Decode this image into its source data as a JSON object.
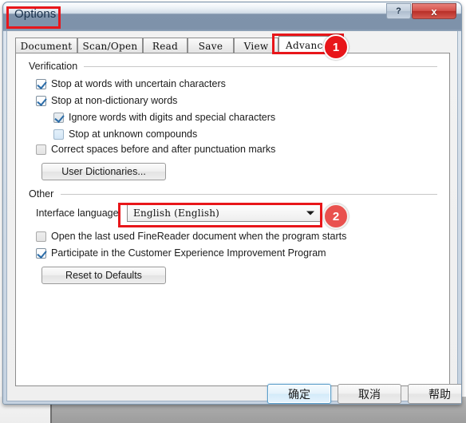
{
  "window": {
    "title": "Options",
    "help_button": "?",
    "close_button": "x"
  },
  "tabs": [
    {
      "label": "Document",
      "active": false
    },
    {
      "label": "Scan/Open",
      "active": false
    },
    {
      "label": "Read",
      "active": false
    },
    {
      "label": "Save",
      "active": false
    },
    {
      "label": "View",
      "active": false
    },
    {
      "label": "Advanced",
      "active": true
    }
  ],
  "groups": {
    "verification": {
      "label": "Verification",
      "checkboxes": [
        {
          "label": "Stop at words with uncertain characters",
          "checked": true,
          "style": "on"
        },
        {
          "label": "Stop at non-dictionary words",
          "checked": true,
          "style": "on"
        },
        {
          "label": "Ignore words with digits and special characters",
          "checked": true,
          "style": "on-dim"
        },
        {
          "label": "Stop at unknown compounds",
          "checked": false,
          "style": "off-blue"
        },
        {
          "label": "Correct spaces before and after punctuation marks",
          "checked": false,
          "style": "off-grey"
        }
      ],
      "button": "User Dictionaries..."
    },
    "other": {
      "label": "Other",
      "interface_language_label": "Interface language:",
      "interface_language_value": "English (English)",
      "checkboxes": [
        {
          "label": "Open the last used FineReader document when the program starts",
          "checked": false,
          "style": "off-grey"
        },
        {
          "label": "Participate in the Customer Experience Improvement Program",
          "checked": true,
          "style": "on"
        }
      ],
      "button": "Reset to Defaults"
    }
  },
  "footer": {
    "ok": "确定",
    "cancel": "取消",
    "help": "帮助"
  },
  "annotations": {
    "badge_1": "1",
    "badge_2": "2"
  },
  "colors": {
    "annotation_red": "#e8161a",
    "titlebar_blue": "#7f93ab",
    "close_red": "#d4514a",
    "check_blue": "#2b6ca8"
  }
}
